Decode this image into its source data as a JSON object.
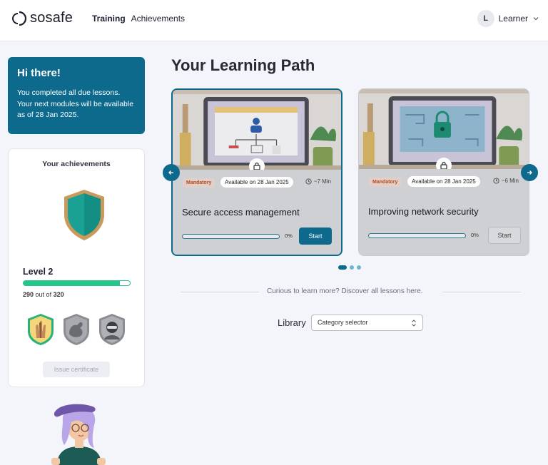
{
  "header": {
    "logo_text": "sosafe",
    "nav": [
      {
        "label": "Training",
        "active": true
      },
      {
        "label": "Achievements",
        "active": false
      }
    ],
    "user": {
      "initial": "L",
      "name": "Learner"
    }
  },
  "greeting": {
    "title": "Hi there!",
    "message": "You completed all due lessons. Your next modules will be available as of 28 Jan 2025."
  },
  "achievements": {
    "title": "Your achievements",
    "level": "Level 2",
    "points_current": "290",
    "points_sep": "out of",
    "points_total": "320",
    "progress_fraction": 0.906,
    "badges": [
      "hands-badge-icon",
      "muscle-badge-icon",
      "hacker-badge-icon"
    ],
    "certificate_button": "Issue certificate"
  },
  "learning_path": {
    "title": "Your Learning Path",
    "cards": [
      {
        "tag": "Mandatory",
        "availability": "Available on 28 Jan 2025",
        "duration": "~7 Min",
        "title": "Secure access management",
        "percent": "0%",
        "button": "Start"
      },
      {
        "tag": "Mandatory",
        "availability": "Available on 28 Jan 2025",
        "duration": "~6 Min",
        "title": "Improving network security",
        "percent": "0%",
        "button": "Start"
      }
    ],
    "pagination": {
      "pages": 3,
      "current": 1
    }
  },
  "library": {
    "curious_text": "Curious to learn more? Discover all lessons here.",
    "label": "Library",
    "category_selector": "Category selector"
  },
  "colors": {
    "accent": "#0d6a8c",
    "success": "#25c48a",
    "background": "#f4f5fb"
  }
}
